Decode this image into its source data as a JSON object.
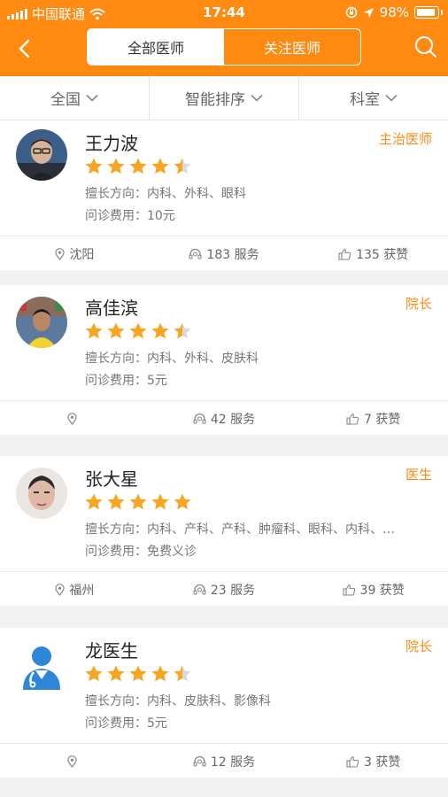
{
  "status_bar": {
    "carrier": "中国联通",
    "time": "17:44",
    "battery": "98%"
  },
  "nav": {
    "tabs": [
      {
        "label": "全部医师",
        "active": true
      },
      {
        "label": "关注医师",
        "active": false
      }
    ]
  },
  "filters": [
    {
      "label": "全国"
    },
    {
      "label": "智能排序"
    },
    {
      "label": "科室"
    }
  ],
  "doctors": [
    {
      "name": "王力波",
      "title": "主治医师",
      "rating": 4.5,
      "specialty": "擅长方向：内科、外科、眼科",
      "fee": "问诊费用：10元",
      "location": "沈阳",
      "services": "183 服务",
      "likes": "135 获赞"
    },
    {
      "name": "高佳滨",
      "title": "院长",
      "rating": 4.5,
      "specialty": "擅长方向：内科、外科、皮肤科",
      "fee": "问诊费用：5元",
      "location": "",
      "services": "42 服务",
      "likes": "7 获赞"
    },
    {
      "name": "张大星",
      "title": "医生",
      "rating": 5,
      "specialty": "擅长方向：内科、产科、产科、肿瘤科、眼科、内科、…",
      "fee": "问诊费用：免费义诊",
      "location": "福州",
      "services": "23 服务",
      "likes": "39 获赞"
    },
    {
      "name": "龙医生",
      "title": "院长",
      "rating": 4.5,
      "specialty": "擅长方向：内科、皮肤科、影像科",
      "fee": "问诊费用：5元",
      "location": "",
      "services": "12 服务",
      "likes": "3 获赞"
    }
  ],
  "colors": {
    "accent": "#ff8a12",
    "star": "#f6a623",
    "star_empty": "#d9d9d9"
  }
}
